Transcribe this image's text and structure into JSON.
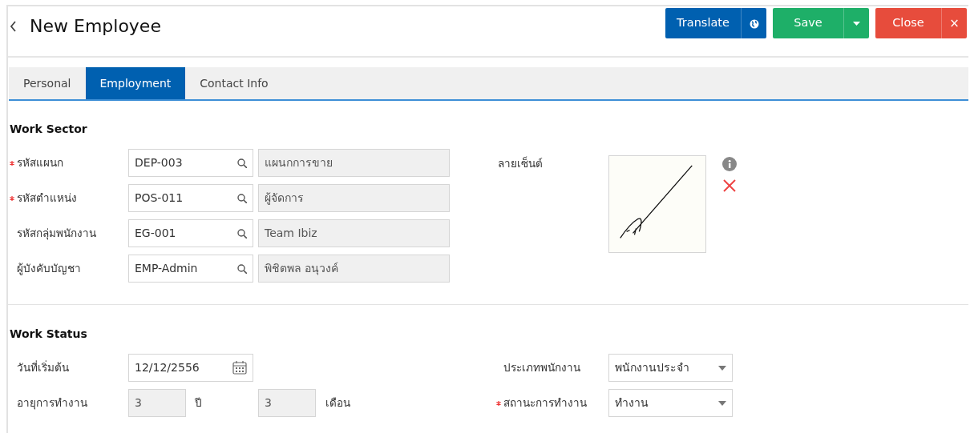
{
  "header": {
    "title": "New Employee",
    "buttons": [
      {
        "label": "Translate",
        "kind": "primary",
        "addon": {
          "kind": "globe"
        }
      },
      {
        "label": "Save",
        "kind": "success",
        "addon": {
          "kind": "caret"
        }
      },
      {
        "label": "Close",
        "kind": "danger",
        "addon": {
          "kind": "text",
          "text": "×"
        }
      }
    ]
  },
  "tabs": [
    {
      "label": "Personal",
      "selected": false
    },
    {
      "label": "Employment",
      "selected": true
    },
    {
      "label": "Contact Info",
      "selected": false
    }
  ],
  "work_sector": {
    "title": "Work Sector",
    "fields": [
      {
        "label": "รหัสแผนก",
        "required": true,
        "code": "DEP-003",
        "name": "แผนกการขาย"
      },
      {
        "label": "รหัสตำแหน่ง",
        "required": true,
        "code": "POS-011",
        "name": "ผู้จัดการ"
      },
      {
        "label": "รหัสกลุ่มพนักงาน",
        "required": false,
        "code": "EG-001",
        "name": "Team Ibiz"
      },
      {
        "label": "ผู้บังคับบัญชา",
        "required": false,
        "code": "EMP-Admin",
        "name": "พิชิตพล อนุวงค์"
      }
    ],
    "signature": {
      "label": "ลายเซ็นต์"
    }
  },
  "work_status": {
    "title": "Work Status",
    "start_date": {
      "label": "วันที่เริ่มต้น",
      "value": "12/12/2556"
    },
    "service_age": {
      "label": "อายุการทำงาน",
      "years": "3",
      "years_unit": "ปี",
      "months": "3",
      "months_unit": "เดือน"
    },
    "selects": [
      {
        "label": "ประเภทพนักงาน",
        "required": false,
        "value": "พนักงานประจำ"
      },
      {
        "label": "สถานะการทำงาน",
        "required": true,
        "value": "ทำงาน"
      }
    ]
  }
}
